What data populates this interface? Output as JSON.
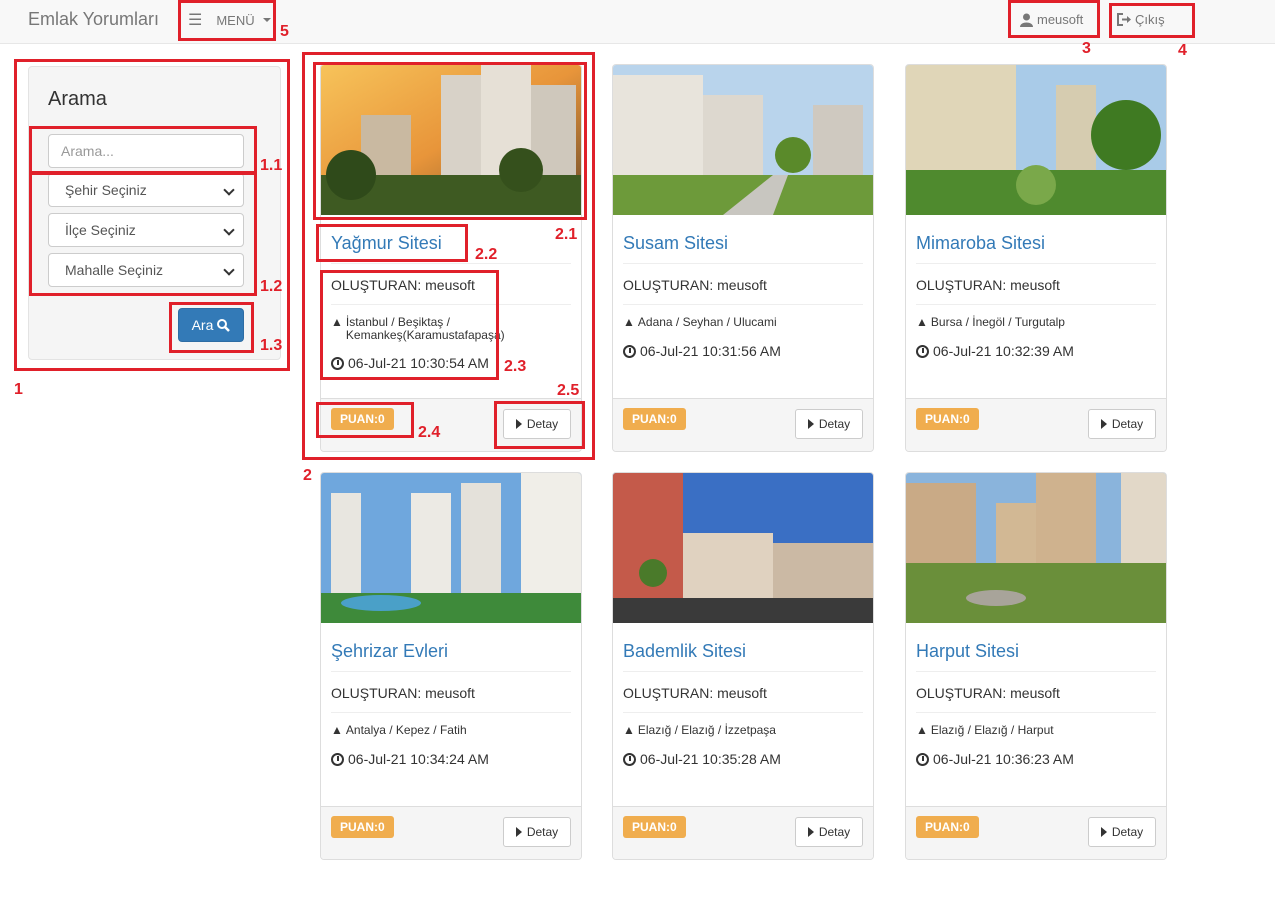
{
  "navbar": {
    "brand": "Emlak Yorumları",
    "menu_label": "MENÜ",
    "user_label": "meusoft",
    "logout_label": "Çıkış"
  },
  "search": {
    "title": "Arama",
    "placeholder": "Arama...",
    "city_select": "Şehir Seçiniz",
    "district_select": "İlçe Seçiniz",
    "neighborhood_select": "Mahalle Seçiniz",
    "button_label": "Ara"
  },
  "annotations": [
    "1",
    "1.1",
    "1.2",
    "1.3",
    "2",
    "2.1",
    "2.2",
    "2.3",
    "2.4",
    "2.5",
    "3",
    "4",
    "5"
  ],
  "listings": [
    {
      "title": "Yağmur Sitesi",
      "creator": "OLUŞTURAN: meusoft",
      "location": "İstanbul / Beşiktaş / Kemankeş(Karamustafapaşa)",
      "date": "06-Jul-21 10:30:54 AM",
      "score": "PUAN:0",
      "button": "Detay"
    },
    {
      "title": "Susam Sitesi",
      "creator": "OLUŞTURAN: meusoft",
      "location": "Adana / Seyhan / Ulucami",
      "date": "06-Jul-21 10:31:56 AM",
      "score": "PUAN:0",
      "button": "Detay"
    },
    {
      "title": "Mimaroba Sitesi",
      "creator": "OLUŞTURAN: meusoft",
      "location": "Bursa / İnegöl / Turgutalp",
      "date": "06-Jul-21 10:32:39 AM",
      "score": "PUAN:0",
      "button": "Detay"
    },
    {
      "title": "Şehrizar Evleri",
      "creator": "OLUŞTURAN: meusoft",
      "location": "Antalya / Kepez / Fatih",
      "date": "06-Jul-21 10:34:24 AM",
      "score": "PUAN:0",
      "button": "Detay"
    },
    {
      "title": "Bademlik Sitesi",
      "creator": "OLUŞTURAN: meusoft",
      "location": "Elazığ / Elazığ / İzzetpaşa",
      "date": "06-Jul-21 10:35:28 AM",
      "score": "PUAN:0",
      "button": "Detay"
    },
    {
      "title": "Harput Sitesi",
      "creator": "OLUŞTURAN: meusoft",
      "location": "Elazığ / Elazığ / Harput",
      "date": "06-Jul-21 10:36:23 AM",
      "score": "PUAN:0",
      "button": "Detay"
    }
  ],
  "colors": {
    "link": "#337ab7",
    "badge": "#f0ad4e",
    "primary": "#337ab7",
    "annotation": "#e0202a"
  },
  "icons": [
    "hamburger-icon",
    "user-icon",
    "logout-icon",
    "search-icon",
    "road-icon",
    "clock-icon",
    "play-icon"
  ]
}
